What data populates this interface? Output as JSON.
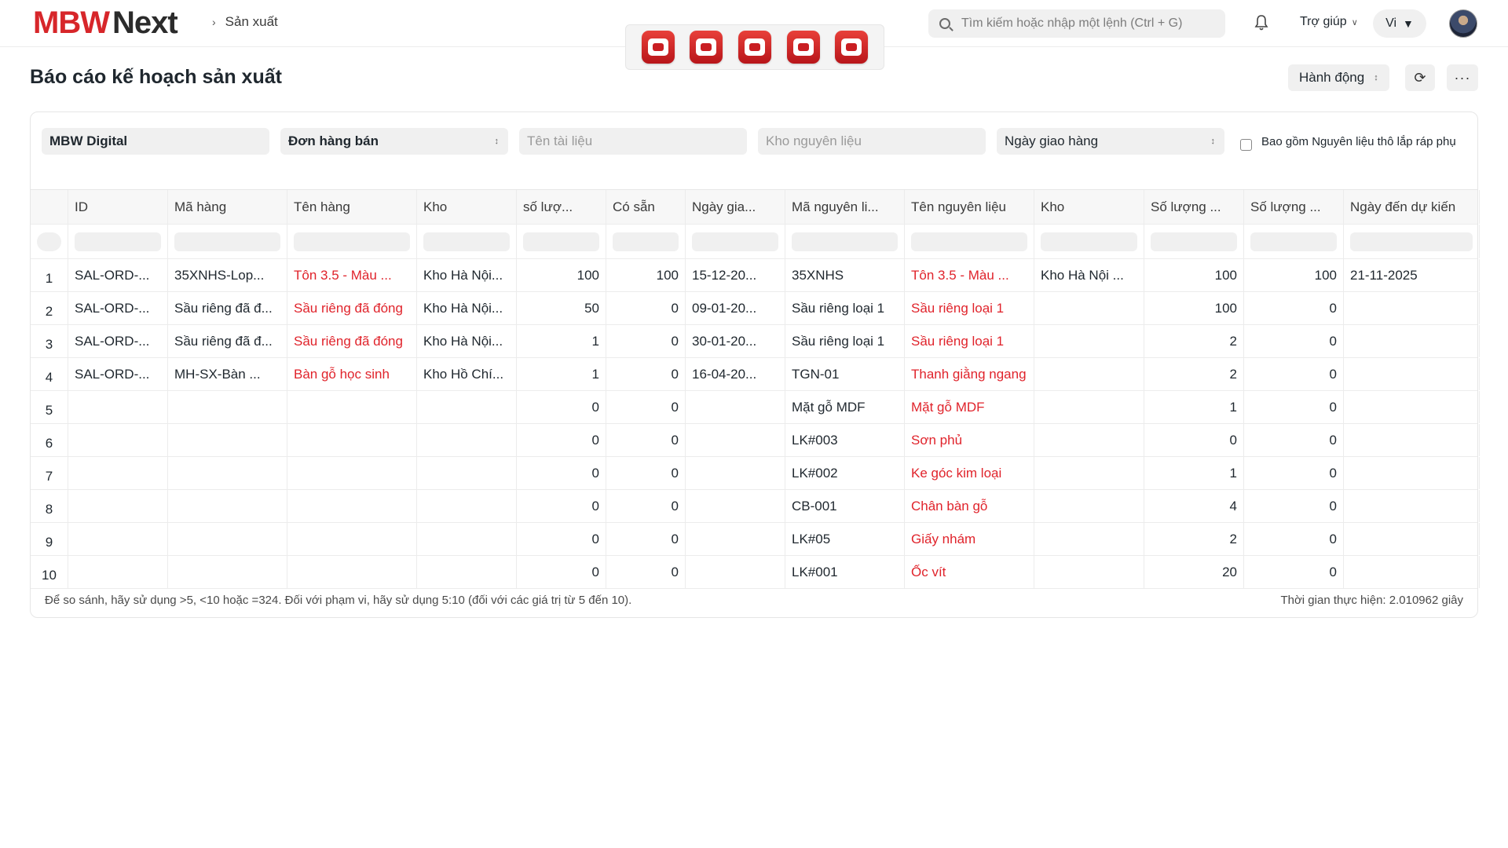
{
  "navbar": {
    "logo_mbw": "MBW",
    "logo_next": "Next",
    "breadcrumb": "Sản xuất",
    "search_placeholder": "Tìm kiếm hoặc nhập một lệnh (Ctrl + G)",
    "help_label": "Trợ giúp",
    "lang_label": "Vi",
    "apps": [
      "app-icon-1",
      "app-icon-2",
      "app-icon-3",
      "app-icon-4",
      "app-icon-5"
    ]
  },
  "page": {
    "title": "Báo cáo kế hoạch sản xuất",
    "action_label": "Hành động",
    "more_label": "···"
  },
  "filters": {
    "company": "MBW Digital",
    "based_on": "Đơn hàng bán",
    "doc_name_placeholder": "Tên tài liệu",
    "warehouse_placeholder": "Kho nguyên liệu",
    "order_by": "Ngày giao hàng",
    "include_subassembly_label": "Bao gồm Nguyên liệu thô lắp ráp phụ"
  },
  "table": {
    "columns": [
      "",
      "ID",
      "Mã hàng",
      "Tên hàng",
      "Kho",
      "số lượ...",
      "Có sẵn",
      "Ngày gia...",
      "Mã nguyên li...",
      "Tên nguyên liệu",
      "Kho",
      "Số lượng ...",
      "Số lượng ...",
      "Ngày đến dự kiến"
    ],
    "rows": [
      [
        "1",
        "SAL-ORD-...",
        "35XNHS-Lop...",
        "Tôn 3.5 - Màu ...",
        "Kho Hà Nội...",
        "100",
        "100",
        "15-12-20...",
        "35XNHS",
        "Tôn 3.5 - Màu ...",
        "Kho Hà Nội ...",
        "100",
        "100",
        "21-11-2025"
      ],
      [
        "2",
        "SAL-ORD-...",
        "Sầu riêng đã đ...",
        "Sầu riêng đã đóng",
        "Kho Hà Nội...",
        "50",
        "0",
        "09-01-20...",
        "Sầu riêng loại 1",
        "Sầu riêng loại 1",
        "",
        "100",
        "0",
        ""
      ],
      [
        "3",
        "SAL-ORD-...",
        "Sầu riêng đã đ...",
        "Sầu riêng đã đóng",
        "Kho Hà Nội...",
        "1",
        "0",
        "30-01-20...",
        "Sầu riêng loại 1",
        "Sầu riêng loại 1",
        "",
        "2",
        "0",
        ""
      ],
      [
        "4",
        "SAL-ORD-...",
        "MH-SX-Bàn ...",
        "Bàn gỗ học sinh",
        "Kho Hồ Chí...",
        "1",
        "0",
        "16-04-20...",
        "TGN-01",
        "Thanh giằng ngang",
        "",
        "2",
        "0",
        ""
      ],
      [
        "5",
        "",
        "",
        "",
        "",
        "0",
        "0",
        "",
        "Mặt gỗ MDF",
        "Mặt gỗ MDF",
        "",
        "1",
        "0",
        ""
      ],
      [
        "6",
        "",
        "",
        "",
        "",
        "0",
        "0",
        "",
        "LK#003",
        "Sơn phủ",
        "",
        "0",
        "0",
        ""
      ],
      [
        "7",
        "",
        "",
        "",
        "",
        "0",
        "0",
        "",
        "LK#002",
        "Ke góc kim loại",
        "",
        "1",
        "0",
        ""
      ],
      [
        "8",
        "",
        "",
        "",
        "",
        "0",
        "0",
        "",
        "CB-001",
        "Chân bàn gỗ",
        "",
        "4",
        "0",
        ""
      ],
      [
        "9",
        "",
        "",
        "",
        "",
        "0",
        "0",
        "",
        "LK#05",
        "Giấy nhám",
        "",
        "2",
        "0",
        ""
      ],
      [
        "10",
        "",
        "",
        "",
        "",
        "0",
        "0",
        "",
        "LK#001",
        "Ốc vít",
        "",
        "20",
        "0",
        ""
      ]
    ],
    "red_text_color": "#e0232b"
  },
  "footer": {
    "hint": "Để so sánh, hãy sử dụng >5, <10 hoặc =324. Đối với phạm vi, hãy sử dụng 5:10 (đối với các giá trị từ 5 đến 10).",
    "execution_time": "Thời gian thực hiện: 2.010962 giây"
  }
}
